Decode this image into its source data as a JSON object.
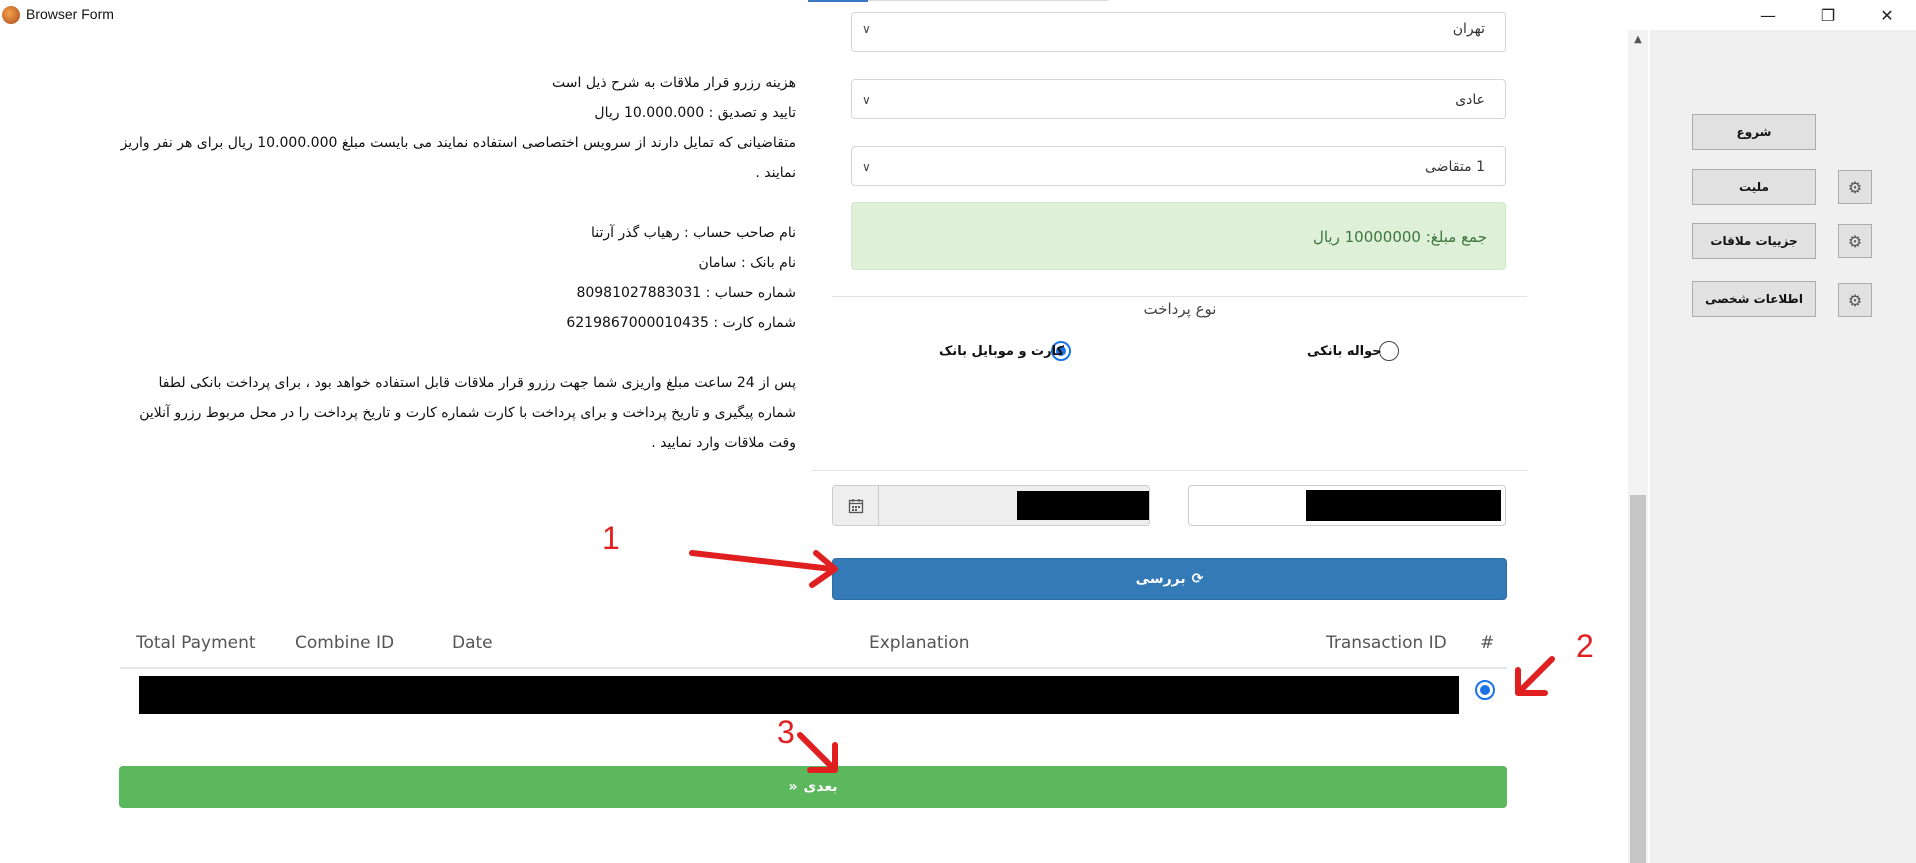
{
  "window": {
    "title": "Browser Form",
    "minimize": "—",
    "restore": "❐",
    "close": "✕"
  },
  "info": {
    "line1": "هزینه رزرو قرار ملاقات به شرح ذیل است",
    "line2": "تایید و تصدیق : 10.000.000 ریال",
    "line3": "متقاضیانی که تمایل دارند از سرویس اختصاصی استفاده نمایند می بایست مبلغ 10.000.000 ریال برای هر نفر واریز نمایند .",
    "account_holder": "نام صاحب حساب : رهیاب گذر آرتنا",
    "bank_name": "نام بانک : سامان",
    "account_number": "شماره حساب : 80981027883031",
    "card_number": "شماره کارت : 6219867000010435",
    "note": "پس از 24 ساعت مبلغ واریزی شما جهت رزرو قرار ملاقات قابل استفاده خواهد بود ، برای پرداخت بانکی لطفا شماره پیگیری و تاریخ پرداخت و برای پرداخت با کارت شماره کارت و تاریخ پرداخت را در محل مربوط رزرو آنلاین وقت ملاقات وارد نمایید ."
  },
  "form": {
    "city_value": "تهران",
    "type_value": "عادی",
    "applicants_value": "1 متقاضی",
    "total": "جمع مبلغ: 10000000 ریال",
    "payment_type_label": "نوع پرداخت",
    "radio_bank_transfer": "حواله بانکی",
    "radio_card": "کارت و موبایل بانک",
    "check_button": "بررسی",
    "next_button": "بعدی"
  },
  "table": {
    "headers": [
      "Total Payment",
      "Combine ID",
      "Date",
      "Explanation",
      "Transaction ID",
      "#"
    ]
  },
  "annotations": [
    "1",
    "2",
    "3"
  ],
  "sidebar": {
    "start": "شروع",
    "nationality": "ملیت",
    "meeting_details": "جزییات ملاقات",
    "personal_info": "اطلاعات شخصی"
  },
  "colors": {
    "primary": "#337ab7",
    "success": "#5cb85c",
    "alert_bg": "#dff0d8",
    "annotation": "#e02020"
  }
}
